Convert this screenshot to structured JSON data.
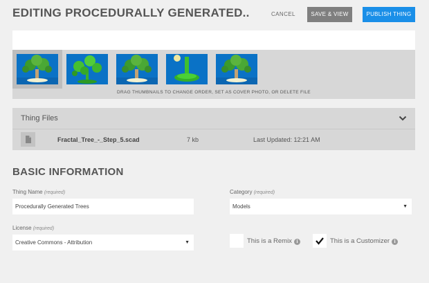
{
  "header": {
    "title": "EDITING PROCEDURALLY GENERATED..",
    "cancel_label": "CANCEL",
    "save_label": "SAVE & VIEW",
    "publish_label": "PUBLISH THING"
  },
  "thumbnails": {
    "items": [
      {
        "selected": true
      },
      {
        "selected": false
      },
      {
        "selected": false
      },
      {
        "selected": false
      },
      {
        "selected": false
      }
    ],
    "hint": "DRAG THUMBNAILS TO CHANGE ORDER, SET AS COVER PHOTO, OR DELETE FILE"
  },
  "files": {
    "title": "Thing Files",
    "rows": [
      {
        "name": "Fractal_Tree_-_Step_5.scad",
        "size": "7 kb",
        "updated": "Last Updated: 12:21 AM"
      }
    ]
  },
  "basic_info": {
    "title": "BASIC INFORMATION",
    "thing_name": {
      "label": "Thing Name",
      "required": "(required)",
      "value": "Procedurally Generated Trees"
    },
    "category": {
      "label": "Category",
      "required": "(required)",
      "value": "Models"
    },
    "license": {
      "label": "License",
      "required": "(required)",
      "value": "Creative Commons - Attribution"
    },
    "remix": {
      "label": "This is a Remix",
      "checked": false
    },
    "customizer": {
      "label": "This is a Customizer",
      "checked": true
    }
  },
  "colors": {
    "accent": "#1a8fe8",
    "save_button": "#7f7f7f",
    "panel": "#d7d7d7",
    "thumb_background": "#0a72c6"
  }
}
